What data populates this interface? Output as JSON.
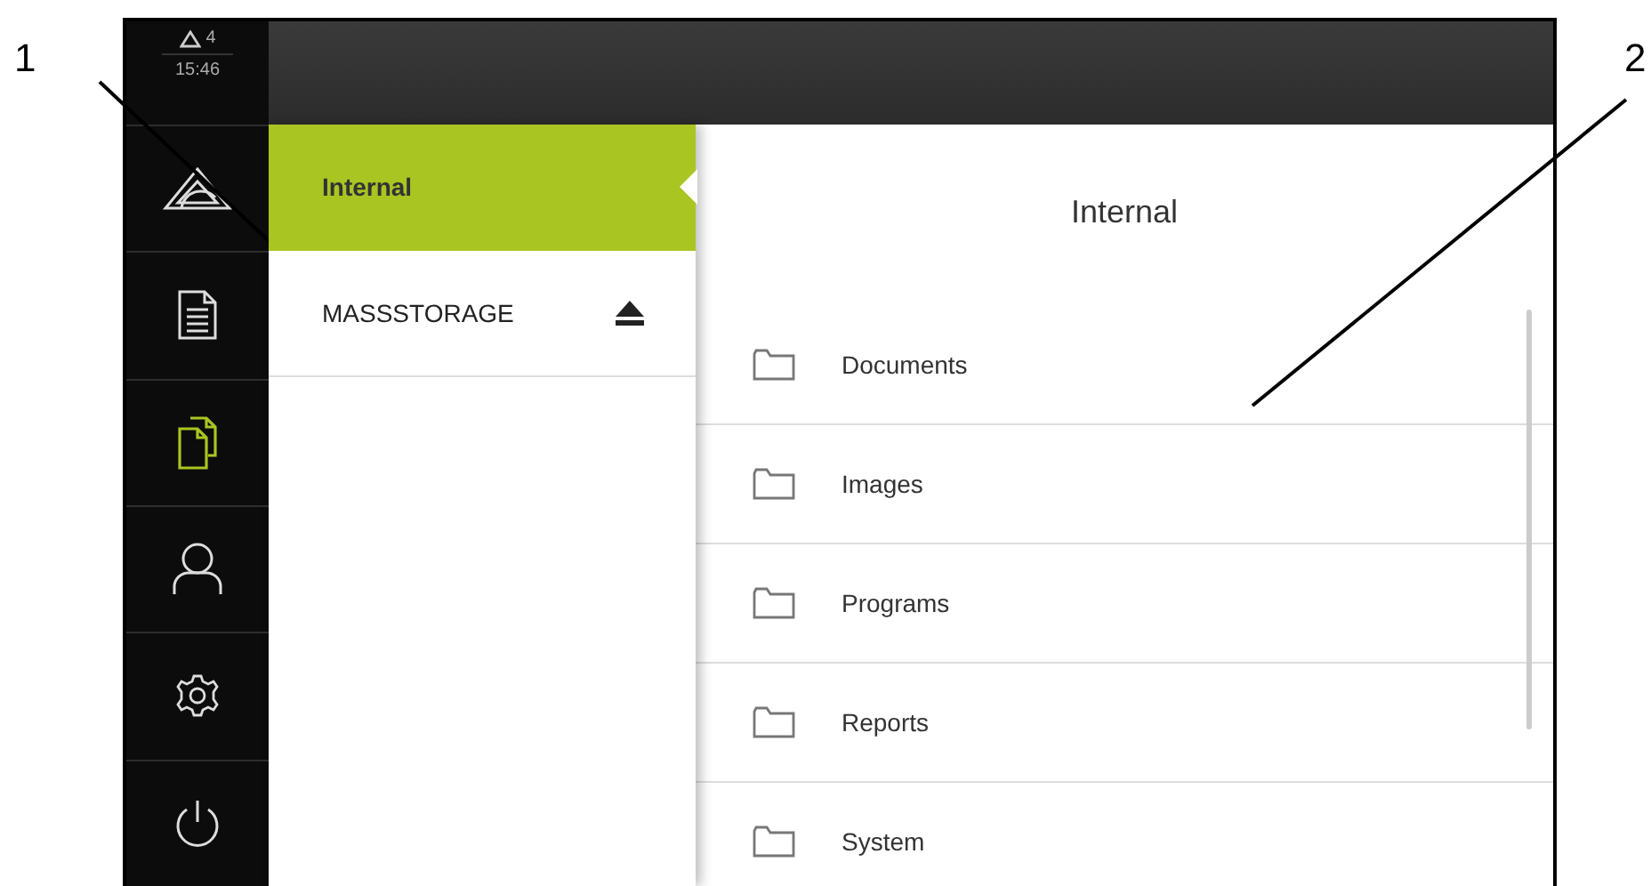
{
  "status": {
    "warnings": "4",
    "time": "15:46"
  },
  "nav": [
    {
      "kind": "measure",
      "selected": false
    },
    {
      "kind": "protocol",
      "selected": false
    },
    {
      "kind": "files",
      "selected": true
    },
    {
      "kind": "user",
      "selected": false
    },
    {
      "kind": "settings",
      "selected": false
    },
    {
      "kind": "power",
      "selected": false
    }
  ],
  "storage": [
    {
      "label": "Internal",
      "selected": true,
      "eject": false
    },
    {
      "label": "MASSSTORAGE",
      "selected": false,
      "eject": true
    }
  ],
  "panel": {
    "title": "Internal",
    "folders": [
      "Documents",
      "Images",
      "Programs",
      "Reports",
      "System"
    ]
  },
  "callouts": [
    {
      "label": "1"
    },
    {
      "label": "2"
    }
  ]
}
